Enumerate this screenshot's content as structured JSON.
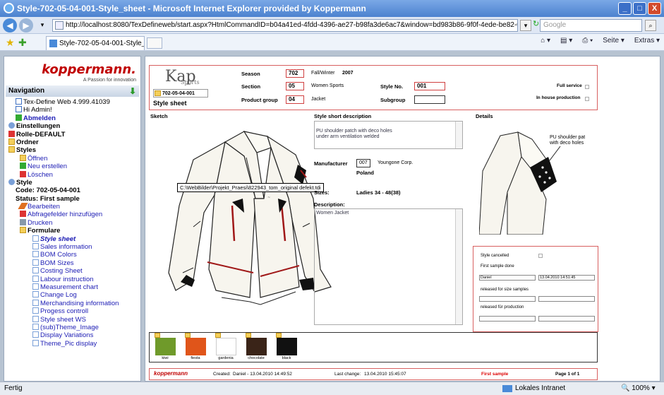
{
  "window": {
    "title": "Style-702-05-04-001-Style_sheet - Microsoft Internet Explorer provided by Koppermann",
    "controls": [
      "_",
      "□",
      "X"
    ]
  },
  "address_bar": {
    "url": "http://localhost:8080/TexDefineweb/start.aspx?HtmlCommandID=b04a41ed-4fdd-4396-ae27-b98fa3de6ac7&window=bd983b86-9f0f-4ede-be82-0dd7e85c2cfe&objectix=3006",
    "search_placeholder": "Google"
  },
  "tab": {
    "label": "Style-702-05-04-001-Style_sheet"
  },
  "command_bar": {
    "page_label": "Seite ▾",
    "extras_label": "Extras ▾"
  },
  "sidebar": {
    "logo": "koppermann.",
    "tagline": "A Passion for innovation",
    "heading": "Navigation",
    "items": [
      {
        "label": "Tex-Define Web 4.999.41039",
        "indent": 14,
        "icon": "doc",
        "style": ""
      },
      {
        "label": "Hi Admin!",
        "indent": 14,
        "icon": "doc",
        "style": ""
      },
      {
        "label": "Abmelden",
        "indent": 14,
        "icon": "grn",
        "style": "b link"
      },
      {
        "label": "Einstellungen",
        "indent": 4,
        "icon": "gear",
        "style": "b"
      },
      {
        "label": "Rolle-DEFAULT",
        "indent": 4,
        "icon": "red",
        "style": "b"
      },
      {
        "label": "Ordner",
        "indent": 4,
        "icon": "fold",
        "style": "b"
      },
      {
        "label": "Styles",
        "indent": 4,
        "icon": "fold",
        "style": "b"
      },
      {
        "label": "Öffnen",
        "indent": 20,
        "icon": "fold",
        "style": "link"
      },
      {
        "label": "Neu erstellen",
        "indent": 20,
        "icon": "grn",
        "style": "link"
      },
      {
        "label": "Löschen",
        "indent": 20,
        "icon": "red",
        "style": "link"
      },
      {
        "label": "Style",
        "indent": 4,
        "icon": "gear",
        "style": "b"
      },
      {
        "label": "Code: 702-05-04-001",
        "indent": 14,
        "icon": "",
        "style": "b"
      },
      {
        "label": "Status: First sample",
        "indent": 14,
        "icon": "",
        "style": "b"
      },
      {
        "label": "Bearbeiten",
        "indent": 20,
        "icon": "pen",
        "style": "link"
      },
      {
        "label": "Abfragefelder hinzufügen",
        "indent": 20,
        "icon": "red",
        "style": "link"
      },
      {
        "label": "Drucken",
        "indent": 20,
        "icon": "print",
        "style": "link"
      },
      {
        "label": "Formulare",
        "indent": 20,
        "icon": "fold",
        "style": "b"
      },
      {
        "label": "Style sheet",
        "indent": 38,
        "icon": "pg",
        "style": "sel"
      },
      {
        "label": "Sales information",
        "indent": 38,
        "icon": "pg",
        "style": "link"
      },
      {
        "label": "BOM Colors",
        "indent": 38,
        "icon": "pg",
        "style": "link"
      },
      {
        "label": "BOM Sizes",
        "indent": 38,
        "icon": "pg",
        "style": "link"
      },
      {
        "label": "Costing Sheet",
        "indent": 38,
        "icon": "pg",
        "style": "link"
      },
      {
        "label": "Labour instruction",
        "indent": 38,
        "icon": "pg",
        "style": "link"
      },
      {
        "label": "Measurement chart",
        "indent": 38,
        "icon": "pg",
        "style": "link"
      },
      {
        "label": "Change Log",
        "indent": 38,
        "icon": "pg",
        "style": "link"
      },
      {
        "label": "Merchandising information",
        "indent": 38,
        "icon": "pg",
        "style": "link"
      },
      {
        "label": "Progess controll",
        "indent": 38,
        "icon": "pg",
        "style": "link"
      },
      {
        "label": "Style sheet WS",
        "indent": 38,
        "icon": "pg",
        "style": "link"
      },
      {
        "label": "(sub)Theme_Image",
        "indent": 38,
        "icon": "pg",
        "style": "link"
      },
      {
        "label": "Display Variations",
        "indent": 38,
        "icon": "pg",
        "style": "link"
      },
      {
        "label": "Theme_Pic display",
        "indent": 38,
        "icon": "pg",
        "style": "link"
      }
    ]
  },
  "sheet": {
    "logo_main": "Kap",
    "logo_sub": "Sports",
    "style_code": "702-05-04-001",
    "title": "Style sheet",
    "season_label": "Season",
    "season_code": "702",
    "season_text": "Fall/Winter",
    "season_year": "2007",
    "section_label": "Section",
    "section_code": "05",
    "section_text": "Women Sports",
    "product_group_label": "Product group",
    "product_group_code": "04",
    "product_group_text": "Jacket",
    "style_no_label": "Style No.",
    "style_no": "001",
    "subgroup_label": "Subgroup",
    "subgroup_value": "",
    "full_service_label": "Full service",
    "inhouse_label": "In house production",
    "sketch_label": "Sketch",
    "short_desc_label": "Style short description",
    "short_desc_text": "PU shoulder patch with deco holes\nunder arm ventilation welded",
    "details_label": "Details",
    "manufacturer_label": "Manufacturer",
    "manufacturer_code": "007",
    "manufacturer_name": "Youngone Corp.",
    "manufacturer_country": "Poland",
    "sizes_label": "Sizes:",
    "sizes_value": "Ladies 34 - 48(38)",
    "description_label": "Description:",
    "description_text": "Women Jacket",
    "tooltip": "C:\\WebBilder\\Projekt_Praesi\\822943_tom_original defekt.tdi",
    "detail_callout": "PU shoulder patch\nwith deco holes",
    "status": {
      "cancelled_label": "Style cancelled",
      "first_sample_label": "First sample done",
      "first_sample_user": "Daniel",
      "first_sample_date": "13.04.2010 14:51:45",
      "released_size_label": "released for size samples",
      "released_prod_label": "released für production"
    },
    "colors": [
      {
        "name": "kiwi",
        "hex": "#6f9a2a"
      },
      {
        "name": "fiesta",
        "hex": "#e0551a"
      },
      {
        "name": "gardenia",
        "hex": "#ffffff"
      },
      {
        "name": "chocolate",
        "hex": "#3a2418"
      },
      {
        "name": "black",
        "hex": "#111111"
      }
    ],
    "footer": {
      "logo": "koppermann",
      "created_label": "Created:",
      "created_value": "Daniel - 13.04.2010 14:49:52",
      "last_change_label": "Last change:",
      "last_change_value": "13.04.2010 15:45:07",
      "status": "First sample",
      "page": "Page 1 of 1"
    }
  },
  "statusbar": {
    "left": "Fertig",
    "zone": "Lokales Intranet",
    "zoom": "100%"
  }
}
